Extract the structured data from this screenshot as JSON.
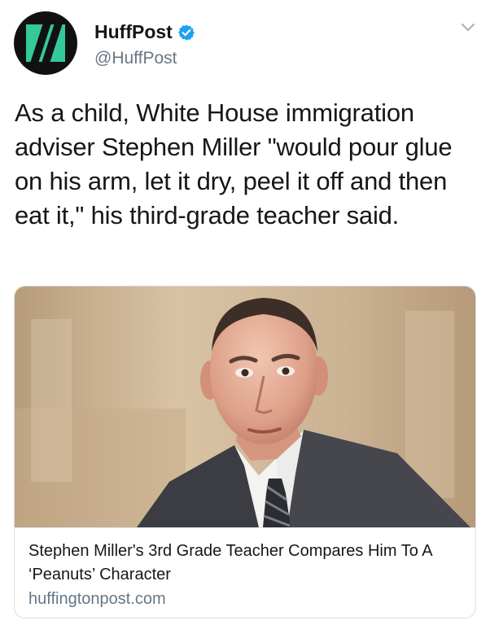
{
  "tweet": {
    "author": {
      "display_name": "HuffPost",
      "handle": "@HuffPost",
      "verified": true,
      "avatar_icon": "huffpost-logo-icon",
      "brand_color": "#35c89a"
    },
    "text": "As a child, White House immigration adviser Stephen Miller \"would pour glue on his arm, let it dry, peel it off and then eat it,\" his third-grade teacher said.",
    "menu_icon": "chevron-down-icon"
  },
  "card": {
    "image": "portrait-photo",
    "title": "Stephen Miller's 3rd Grade Teacher Compares Him To A ‘Peanuts’ Character",
    "domain": "huffingtonpost.com"
  },
  "colors": {
    "text": "#14171a",
    "secondary": "#657786",
    "verified": "#1da1f2",
    "border": "#d8dee3"
  }
}
